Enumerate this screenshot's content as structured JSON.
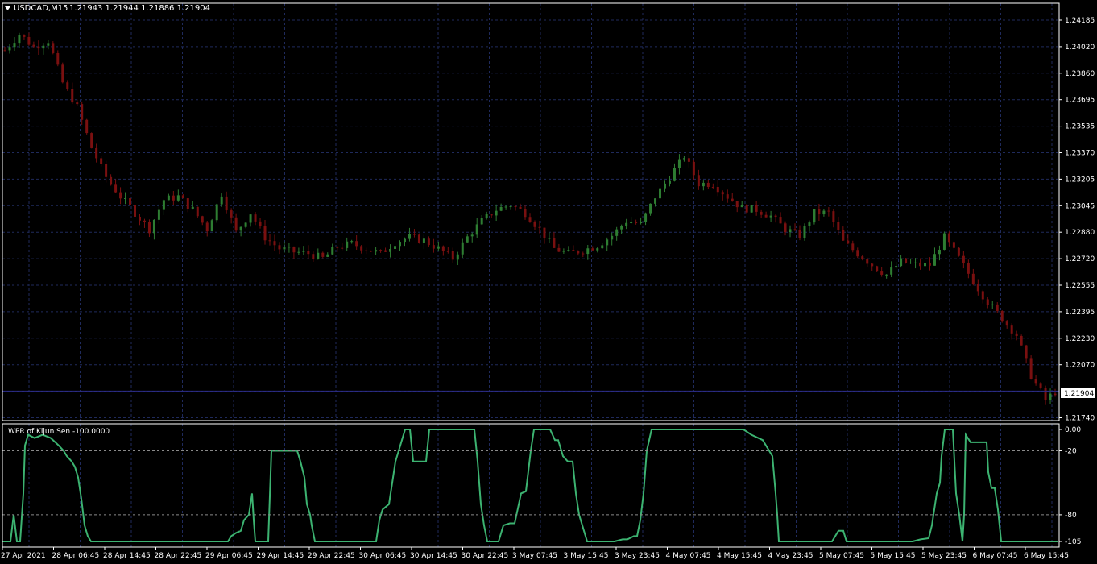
{
  "symbol_header": {
    "symbol": "USDCAD,M15",
    "ohlc": "1.21943 1.21944 1.21886 1.21904"
  },
  "current_price": "1.21904",
  "indicator_label": "WPR of Kijun Sen -100.0000",
  "colors": {
    "background": "#000000",
    "grid": "#1f2a5c",
    "frame": "#ffffff",
    "bull_candle": "#2e7d32",
    "bear_candle": "#7a1010",
    "wpr_line": "#3cb371",
    "level_line": "#8a8a8a",
    "price_line": "#2d2d8a"
  },
  "chart_data": [
    {
      "type": "candlestick",
      "title": "USDCAD,M15",
      "x_labels": [
        "27 Apr 2021",
        "28 Apr 06:45",
        "28 Apr 14:45",
        "28 Apr 22:45",
        "29 Apr 06:45",
        "29 Apr 14:45",
        "29 Apr 22:45",
        "30 Apr 06:45",
        "30 Apr 14:45",
        "30 Apr 22:45",
        "3 May 07:45",
        "3 May 15:45",
        "3 May 23:45",
        "4 May 07:45",
        "4 May 15:45",
        "4 May 23:45",
        "5 May 07:45",
        "5 May 15:45",
        "5 May 23:45",
        "6 May 07:45",
        "6 May 15:45"
      ],
      "y_tick_labels": [
        "1.24185",
        "1.24020",
        "1.23860",
        "1.23695",
        "1.23535",
        "1.23370",
        "1.23205",
        "1.23045",
        "1.22880",
        "1.22720",
        "1.22555",
        "1.22395",
        "1.22230",
        "1.22070",
        "1.21904",
        "1.21740"
      ],
      "ylim": [
        1.2174,
        1.24185
      ],
      "close_path": [
        [
          0,
          1.24
        ],
        [
          3,
          1.241
        ],
        [
          6,
          1.2402
        ],
        [
          9,
          1.2406
        ],
        [
          12,
          1.238
        ],
        [
          15,
          1.2365
        ],
        [
          18,
          1.234
        ],
        [
          21,
          1.2322
        ],
        [
          24,
          1.231
        ],
        [
          27,
          1.23
        ],
        [
          30,
          1.229
        ],
        [
          33,
          1.2308
        ],
        [
          36,
          1.231
        ],
        [
          39,
          1.2302
        ],
        [
          42,
          1.229
        ],
        [
          45,
          1.2312
        ],
        [
          48,
          1.2288
        ],
        [
          51,
          1.23
        ],
        [
          54,
          1.2285
        ],
        [
          57,
          1.2278
        ],
        [
          60,
          1.2276
        ],
        [
          63,
          1.2275
        ],
        [
          66,
          1.2272
        ],
        [
          69,
          1.2279
        ],
        [
          72,
          1.2281
        ],
        [
          75,
          1.2278
        ],
        [
          78,
          1.2275
        ],
        [
          81,
          1.2282
        ],
        [
          84,
          1.2285
        ],
        [
          87,
          1.2283
        ],
        [
          90,
          1.2278
        ],
        [
          93,
          1.2272
        ],
        [
          96,
          1.2285
        ],
        [
          99,
          1.2295
        ],
        [
          102,
          1.2302
        ],
        [
          105,
          1.2305
        ],
        [
          108,
          1.23
        ],
        [
          111,
          1.229
        ],
        [
          114,
          1.2278
        ],
        [
          117,
          1.2275
        ],
        [
          120,
          1.2277
        ],
        [
          123,
          1.228
        ],
        [
          126,
          1.2286
        ],
        [
          129,
          1.2295
        ],
        [
          132,
          1.2293
        ],
        [
          135,
          1.231
        ],
        [
          138,
          1.2322
        ],
        [
          141,
          1.2335
        ],
        [
          144,
          1.2318
        ],
        [
          147,
          1.2318
        ],
        [
          150,
          1.231
        ],
        [
          153,
          1.2303
        ],
        [
          156,
          1.2302
        ],
        [
          159,
          1.2298
        ],
        [
          162,
          1.229
        ],
        [
          165,
          1.2286
        ],
        [
          168,
          1.23
        ],
        [
          171,
          1.23
        ],
        [
          174,
          1.2282
        ],
        [
          177,
          1.2275
        ],
        [
          180,
          1.2268
        ],
        [
          183,
          1.2262
        ],
        [
          186,
          1.227
        ],
        [
          189,
          1.2268
        ],
        [
          192,
          1.2268
        ],
        [
          195,
          1.2285
        ],
        [
          198,
          1.2272
        ],
        [
          201,
          1.2258
        ],
        [
          204,
          1.2245
        ],
        [
          207,
          1.2235
        ],
        [
          210,
          1.2225
        ],
        [
          213,
          1.22
        ],
        [
          216,
          1.2185
        ],
        [
          218,
          1.219
        ]
      ]
    },
    {
      "type": "line",
      "title": "WPR of Kijun Sen -100.0000",
      "y_tick_labels": [
        "0.00",
        "-20",
        "-80",
        "-105"
      ],
      "ylim": [
        -105,
        0
      ],
      "levels": [
        -20,
        -80
      ],
      "series": [
        {
          "points": [
            [
              0,
              -105
            ],
            [
              10,
              -105
            ],
            [
              14,
              -80
            ],
            [
              18,
              -105
            ],
            [
              22,
              -105
            ],
            [
              26,
              -60
            ],
            [
              28,
              -15
            ],
            [
              32,
              -5
            ],
            [
              40,
              -8
            ],
            [
              50,
              -5
            ],
            [
              60,
              -8
            ],
            [
              70,
              -15
            ],
            [
              76,
              -20
            ],
            [
              80,
              -25
            ],
            [
              86,
              -30
            ],
            [
              90,
              -35
            ],
            [
              94,
              -45
            ],
            [
              98,
              -65
            ],
            [
              102,
              -90
            ],
            [
              106,
              -100
            ],
            [
              110,
              -105
            ],
            [
              150,
              -105
            ],
            [
              210,
              -105
            ],
            [
              250,
              -105
            ],
            [
              280,
              -105
            ],
            [
              284,
              -100
            ],
            [
              290,
              -97
            ],
            [
              296,
              -95
            ],
            [
              300,
              -85
            ],
            [
              306,
              -80
            ],
            [
              310,
              -60
            ],
            [
              312,
              -85
            ],
            [
              314,
              -105
            ],
            [
              330,
              -105
            ],
            [
              334,
              -20
            ],
            [
              360,
              -20
            ],
            [
              366,
              -20
            ],
            [
              370,
              -30
            ],
            [
              375,
              -45
            ],
            [
              378,
              -70
            ],
            [
              382,
              -80
            ],
            [
              384,
              -90
            ],
            [
              388,
              -105
            ],
            [
              440,
              -105
            ],
            [
              464,
              -105
            ],
            [
              468,
              -85
            ],
            [
              472,
              -75
            ],
            [
              480,
              -70
            ],
            [
              484,
              -50
            ],
            [
              488,
              -30
            ],
            [
              492,
              -20
            ],
            [
              496,
              -10
            ],
            [
              500,
              0
            ],
            [
              506,
              0
            ],
            [
              510,
              -30
            ],
            [
              518,
              -30
            ],
            [
              526,
              -30
            ],
            [
              530,
              0
            ],
            [
              550,
              0
            ],
            [
              580,
              0
            ],
            [
              586,
              0
            ],
            [
              590,
              -30
            ],
            [
              594,
              -70
            ],
            [
              598,
              -90
            ],
            [
              602,
              -105
            ],
            [
              616,
              -105
            ],
            [
              622,
              -90
            ],
            [
              630,
              -88
            ],
            [
              636,
              -88
            ],
            [
              644,
              -60
            ],
            [
              650,
              -58
            ],
            [
              656,
              -20
            ],
            [
              660,
              0
            ],
            [
              670,
              0
            ],
            [
              680,
              0
            ],
            [
              686,
              -10
            ],
            [
              690,
              -10
            ],
            [
              696,
              -25
            ],
            [
              702,
              -30
            ],
            [
              708,
              -30
            ],
            [
              712,
              -60
            ],
            [
              716,
              -80
            ],
            [
              720,
              -90
            ],
            [
              726,
              -105
            ],
            [
              760,
              -105
            ],
            [
              770,
              -103
            ],
            [
              776,
              -103
            ],
            [
              784,
              -100
            ],
            [
              788,
              -100
            ],
            [
              792,
              -85
            ],
            [
              796,
              -60
            ],
            [
              800,
              -20
            ],
            [
              806,
              0
            ],
            [
              820,
              0
            ],
            [
              850,
              0
            ],
            [
              880,
              0
            ],
            [
              900,
              0
            ],
            [
              920,
              0
            ],
            [
              930,
              -5
            ],
            [
              944,
              -10
            ],
            [
              952,
              -20
            ],
            [
              956,
              -25
            ],
            [
              960,
              -60
            ],
            [
              962,
              -80
            ],
            [
              964,
              -105
            ],
            [
              1030,
              -105
            ],
            [
              1038,
              -95
            ],
            [
              1044,
              -95
            ],
            [
              1048,
              -105
            ],
            [
              1130,
              -105
            ],
            [
              1140,
              -103
            ],
            [
              1150,
              -102
            ],
            [
              1154,
              -90
            ],
            [
              1160,
              -60
            ],
            [
              1164,
              -50
            ],
            [
              1166,
              -25
            ],
            [
              1170,
              0
            ],
            [
              1180,
              0
            ],
            [
              1184,
              -60
            ],
            [
              1188,
              -80
            ],
            [
              1192,
              -105
            ],
            [
              1194,
              -80
            ],
            [
              1196,
              -5
            ],
            [
              1202,
              -12
            ],
            [
              1210,
              -12
            ],
            [
              1222,
              -12
            ],
            [
              1224,
              -40
            ],
            [
              1228,
              -55
            ],
            [
              1232,
              -55
            ],
            [
              1236,
              -75
            ],
            [
              1240,
              -105
            ],
            [
              1310,
              -105
            ]
          ]
        }
      ]
    }
  ]
}
